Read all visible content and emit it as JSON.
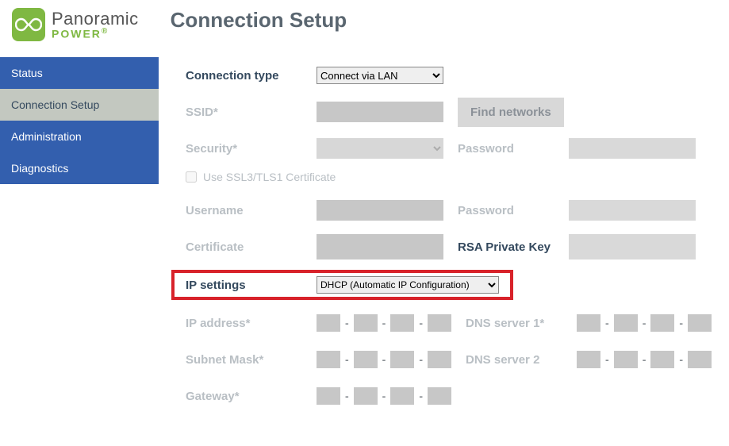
{
  "brand": {
    "top": "Panoramic",
    "bottom": "POWER"
  },
  "page_title": "Connection Setup",
  "sidebar": {
    "items": [
      {
        "label": "Status",
        "active": false
      },
      {
        "label": "Connection Setup",
        "active": true
      },
      {
        "label": "Administration",
        "active": false
      },
      {
        "label": "Diagnostics",
        "active": false
      }
    ]
  },
  "form": {
    "connection_type": {
      "label": "Connection type",
      "value": "Connect via LAN"
    },
    "ssid": {
      "label": "SSID*",
      "value": ""
    },
    "find_networks": "Find networks",
    "security": {
      "label": "Security*",
      "value": ""
    },
    "password1": {
      "label": "Password",
      "value": ""
    },
    "ssl_label": "Use SSL3/TLS1 Certificate",
    "username": {
      "label": "Username",
      "value": ""
    },
    "password2": {
      "label": "Password",
      "value": ""
    },
    "certificate": {
      "label": "Certificate",
      "value": ""
    },
    "rsa": {
      "label": "RSA Private Key",
      "value": ""
    },
    "ip_settings": {
      "label": "IP settings",
      "value": "DHCP (Automatic IP Configuration)"
    },
    "ip_address": {
      "label": "IP address*"
    },
    "dns1": {
      "label": "DNS server 1*"
    },
    "subnet": {
      "label": "Subnet Mask*"
    },
    "dns2": {
      "label": "DNS server 2"
    },
    "gateway": {
      "label": "Gateway*"
    }
  }
}
